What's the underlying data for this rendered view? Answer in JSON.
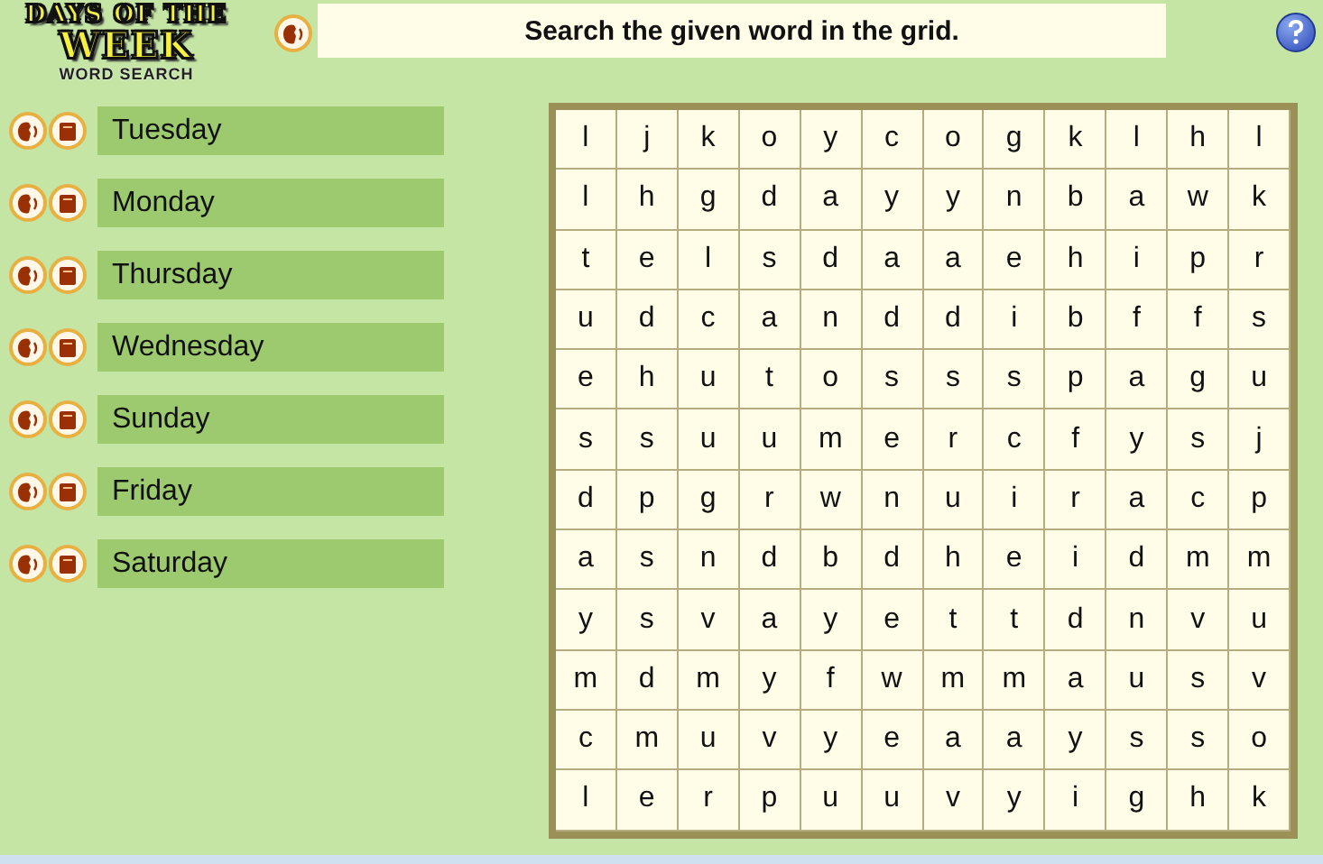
{
  "logo": {
    "line_1": "DAYS OF THE",
    "line_2": "WEEK",
    "line_3": "WORD SEARCH"
  },
  "instruction": "Search the given word in the grid.",
  "words": [
    "Tuesday",
    "Monday",
    "Thursday",
    "Wednesday",
    "Sunday",
    "Friday",
    "Saturday"
  ],
  "grid": [
    [
      "l",
      "j",
      "k",
      "o",
      "y",
      "c",
      "o",
      "g",
      "k",
      "l",
      "h",
      "l"
    ],
    [
      "l",
      "h",
      "g",
      "d",
      "a",
      "y",
      "y",
      "n",
      "b",
      "a",
      "w",
      "k"
    ],
    [
      "t",
      "e",
      "l",
      "s",
      "d",
      "a",
      "a",
      "e",
      "h",
      "i",
      "p",
      "r"
    ],
    [
      "u",
      "d",
      "c",
      "a",
      "n",
      "d",
      "d",
      "i",
      "b",
      "f",
      "f",
      "s"
    ],
    [
      "e",
      "h",
      "u",
      "t",
      "o",
      "s",
      "s",
      "s",
      "p",
      "a",
      "g",
      "u"
    ],
    [
      "s",
      "s",
      "u",
      "u",
      "m",
      "e",
      "r",
      "c",
      "f",
      "y",
      "s",
      "j"
    ],
    [
      "d",
      "p",
      "g",
      "r",
      "w",
      "n",
      "u",
      "i",
      "r",
      "a",
      "c",
      "p"
    ],
    [
      "a",
      "s",
      "n",
      "d",
      "b",
      "d",
      "h",
      "e",
      "i",
      "d",
      "m",
      "m"
    ],
    [
      "y",
      "s",
      "v",
      "a",
      "y",
      "e",
      "t",
      "t",
      "d",
      "n",
      "v",
      "u"
    ],
    [
      "m",
      "d",
      "m",
      "y",
      "f",
      "w",
      "m",
      "m",
      "a",
      "u",
      "s",
      "v"
    ],
    [
      "c",
      "m",
      "u",
      "v",
      "y",
      "e",
      "a",
      "a",
      "y",
      "s",
      "s",
      "o"
    ],
    [
      "l",
      "e",
      "r",
      "p",
      "u",
      "u",
      "v",
      "y",
      "i",
      "g",
      "h",
      "k"
    ]
  ]
}
